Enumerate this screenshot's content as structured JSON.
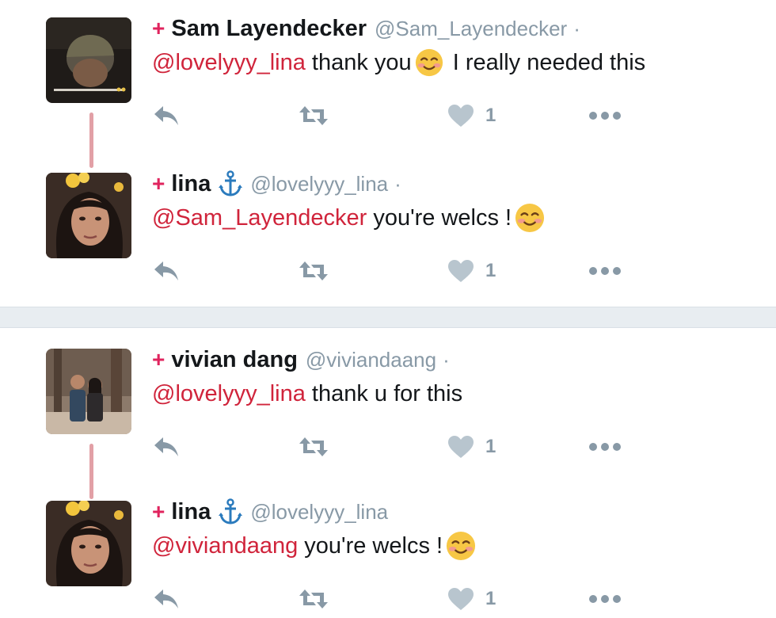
{
  "colors": {
    "mention": "#d0243b",
    "muted": "#8899a6",
    "connector": "#e2a0a6",
    "separator": "#e8edf1",
    "plus": "#e0245e",
    "anchor": "#2b7bbd"
  },
  "threads": [
    {
      "tweets": [
        {
          "plus": "+",
          "name": "Sam Layendecker",
          "handle": "@Sam_Layendecker",
          "dot": "·",
          "mention": "@lovelyyy_lina",
          "text_before": " thank you",
          "emoji": "smiling-blush-emoji",
          "text_after": " I really needed this",
          "likes": "1",
          "verified_icon": null
        },
        {
          "plus": "+",
          "name": "lina",
          "handle": "@lovelyyy_lina",
          "dot": "·",
          "mention": "@Sam_Layendecker",
          "text_before": " you're welcs !",
          "emoji": "smiling-blush-emoji",
          "text_after": "",
          "likes": "1",
          "verified_icon": "anchor-icon"
        }
      ]
    },
    {
      "tweets": [
        {
          "plus": "+",
          "name": "vivian dang",
          "handle": "@viviandaang",
          "dot": "·",
          "mention": "@lovelyyy_lina",
          "text_before": " thank u for this",
          "emoji": null,
          "text_after": "",
          "likes": "1",
          "verified_icon": null
        },
        {
          "plus": "+",
          "name": "lina",
          "handle": "@lovelyyy_lina",
          "dot": "",
          "mention": "@viviandaang",
          "text_before": " you're welcs !",
          "emoji": "smiling-blush-emoji",
          "text_after": "",
          "likes": "1",
          "verified_icon": "anchor-icon"
        }
      ]
    }
  ],
  "icons": {
    "reply": "reply-icon",
    "retweet": "retweet-icon",
    "like": "heart-icon",
    "more": "more-dots-icon"
  }
}
